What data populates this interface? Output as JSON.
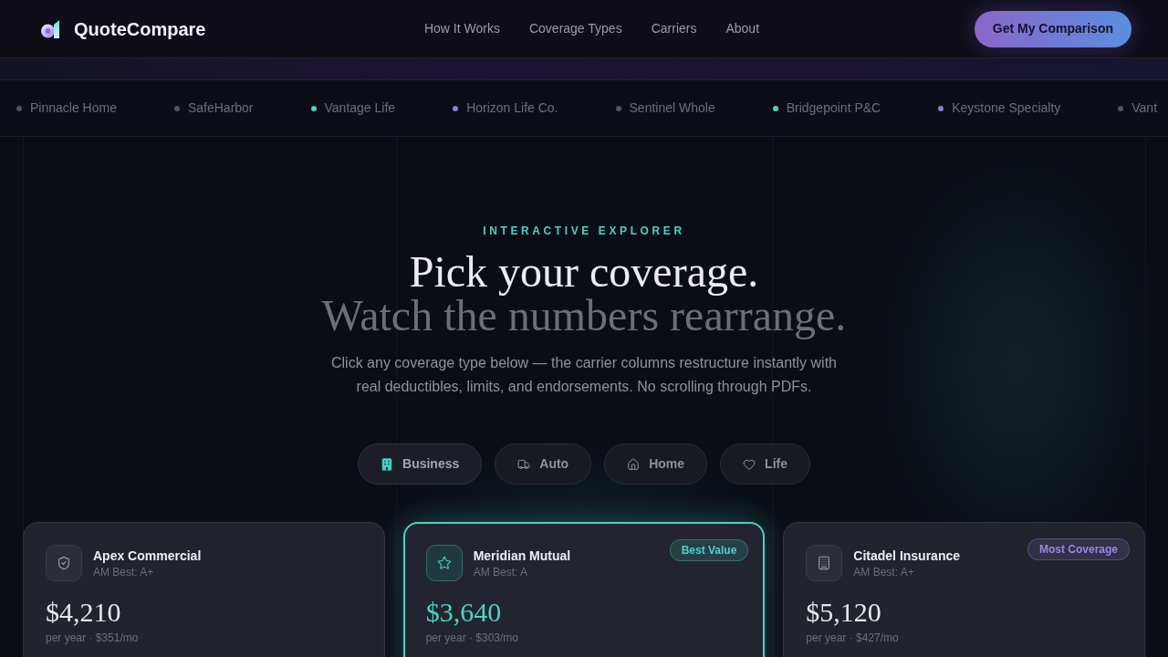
{
  "header": {
    "brand": "QuoteCompare",
    "nav": [
      {
        "label": "How It Works"
      },
      {
        "label": "Coverage Types"
      },
      {
        "label": "Carriers"
      },
      {
        "label": "About"
      }
    ],
    "cta": "Get My Comparison"
  },
  "ticker": [
    {
      "name": "Pinnacle Home",
      "color": "#4b5563"
    },
    {
      "name": "SafeHarbor",
      "color": "#4b5563"
    },
    {
      "name": "Vantage Life",
      "color": "#4fd1c5"
    },
    {
      "name": "Horizon Life Co.",
      "color": "#8b7bd8"
    },
    {
      "name": "Sentinel Whole",
      "color": "#4b5563"
    },
    {
      "name": "Bridgepoint P&C",
      "color": "#4fd1c5"
    },
    {
      "name": "Keystone Specialty",
      "color": "#8b7bd8"
    },
    {
      "name": "Vant",
      "color": "#4b5563"
    }
  ],
  "hero": {
    "eyebrow": "INTERACTIVE EXPLORER",
    "title_line_1": "Pick your coverage.",
    "title_line_2": "Watch the numbers rearrange.",
    "description": "Click any coverage type below — the carrier columns restructure instantly with real deductibles, limits, and endorsements. No scrolling through PDFs."
  },
  "coverage_types": [
    {
      "label": "Business",
      "selected": true
    },
    {
      "label": "Auto",
      "selected": false
    },
    {
      "label": "Home",
      "selected": false
    },
    {
      "label": "Life",
      "selected": false
    }
  ],
  "carriers": [
    {
      "name": "Apex Commercial",
      "rating": "AM Best: A+",
      "price": "$4,210",
      "detail": "per year · $351/mo",
      "highlighted": false
    },
    {
      "name": "Meridian Mutual",
      "rating": "AM Best: A",
      "price": "$3,640",
      "detail": "per year · $303/mo",
      "highlighted": true,
      "badge": {
        "label": "Best Value",
        "color": "#4fd1c5"
      }
    },
    {
      "name": "Citadel Insurance",
      "rating": "AM Best: A+",
      "price": "$5,120",
      "detail": "per year · $427/mo",
      "highlighted": false,
      "badge": {
        "label": "Most Coverage",
        "color": "#9b87e0"
      }
    }
  ]
}
